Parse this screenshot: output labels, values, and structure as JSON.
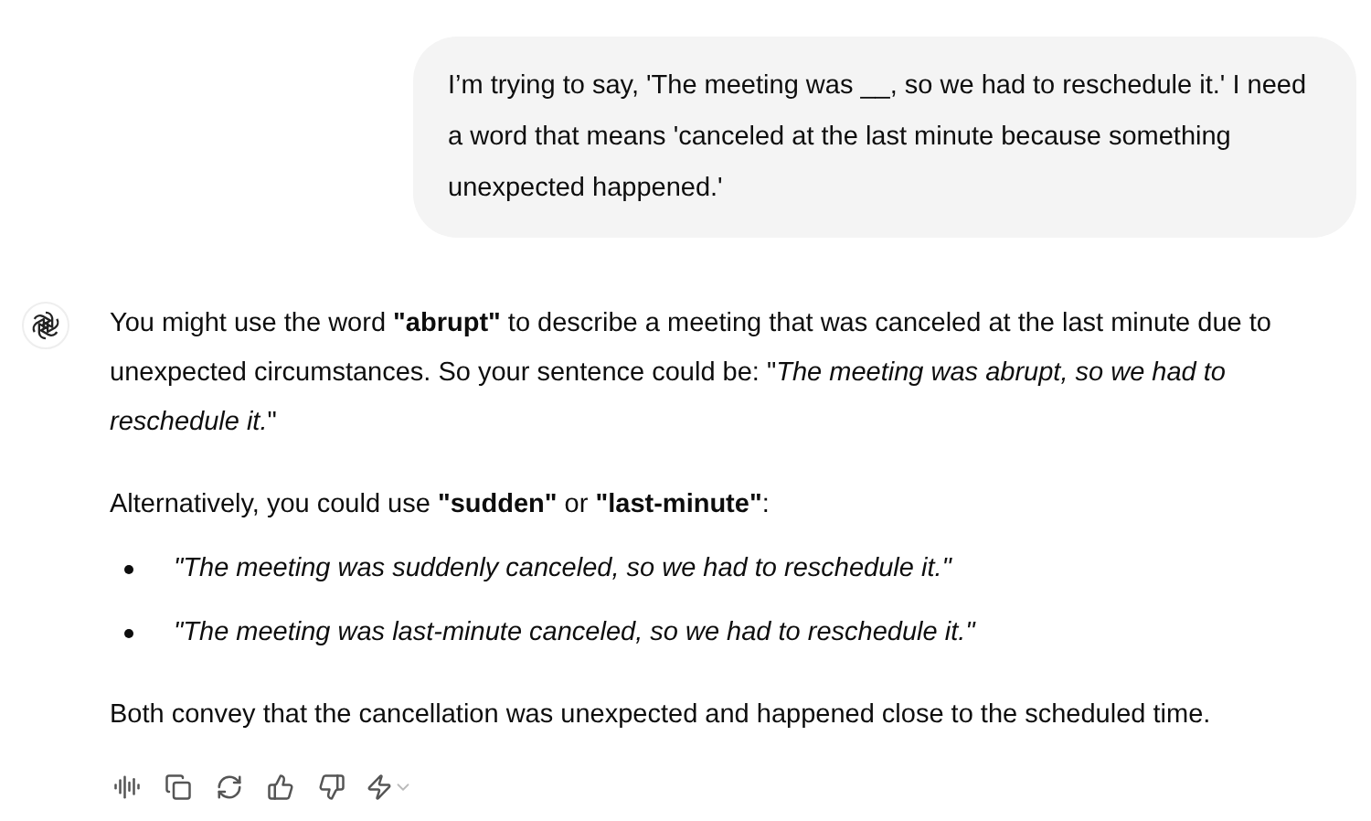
{
  "user_message": "I’m trying to say, 'The meeting was __, so we had to reschedule it.' I need a word that means 'canceled at the last minute because something unexpected happened.'",
  "reply": {
    "paragraph_1": "You might use the word **\"abrupt\"** to describe a meeting that was canceled at the last minute due to unexpected circumstances. So your sentence could be: \"*The meeting was abrupt, so we had to reschedule it.*\"",
    "paragraph_2": "Alternatively, you could use **\"sudden\"** or **\"last-minute\"**:",
    "bullets": [
      "\"The meeting was suddenly canceled, so we had to reschedule it.\"",
      "\"The meeting was last-minute canceled, so we had to reschedule it.\""
    ],
    "paragraph_3": "Both convey that the cancellation was unexpected and happened close to the scheduled time."
  }
}
